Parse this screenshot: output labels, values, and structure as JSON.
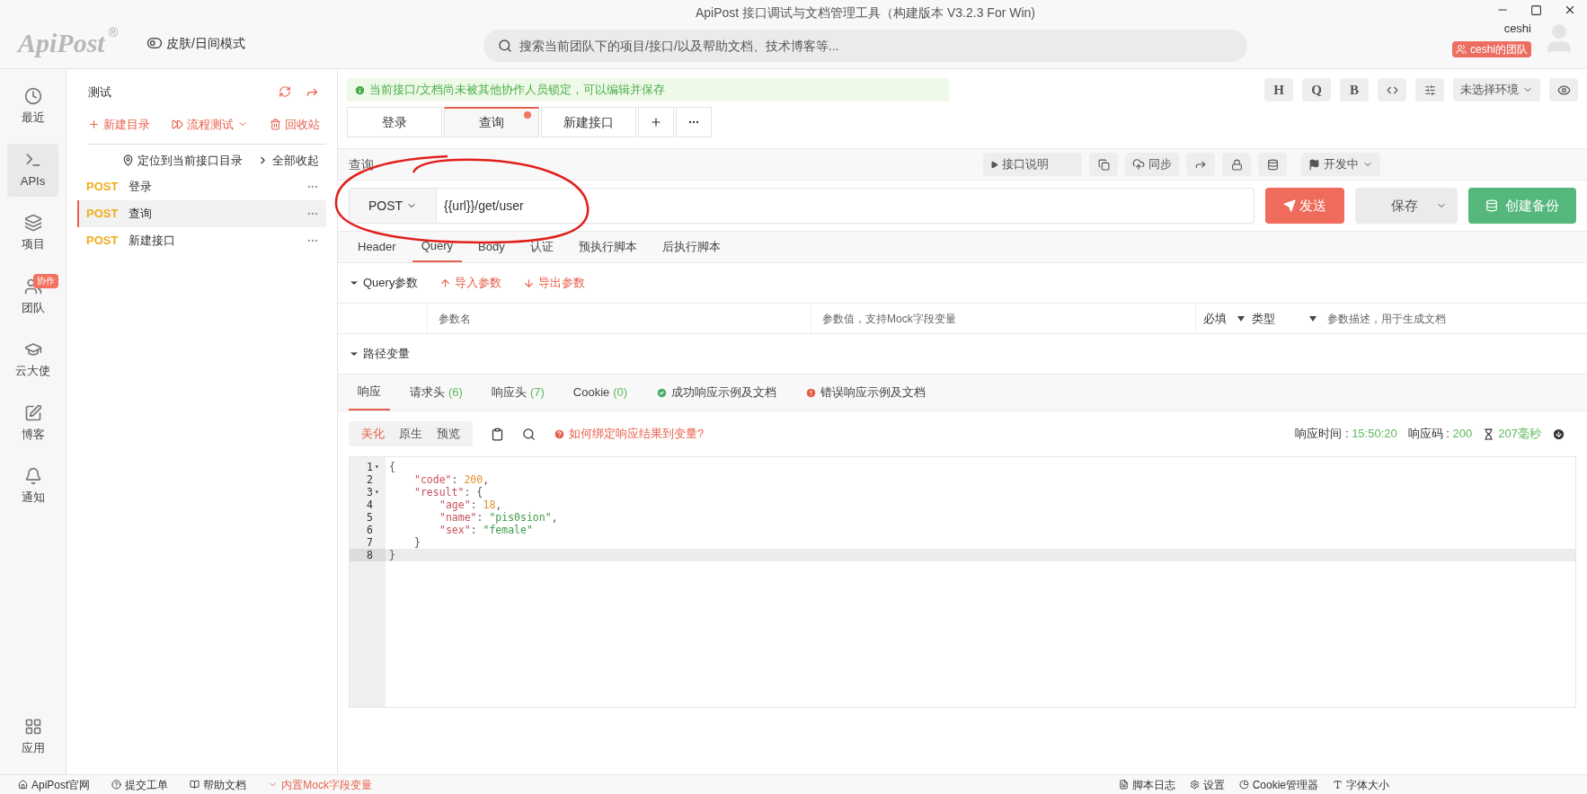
{
  "window": {
    "title": "ApiPost 接口调试与文档管理工具（构建版本 V3.2.3 For Win)"
  },
  "header": {
    "logo": "ApiPost",
    "logo_mark": "®",
    "theme_toggle": {
      "label": "皮肤/日间模式",
      "on": false
    },
    "search": {
      "placeholder": "搜索当前团队下的项目/接口/以及帮助文档、技术博客等..."
    },
    "user": {
      "name": "ceshi",
      "team": "ceshi的团队"
    }
  },
  "sidebar": {
    "items": [
      {
        "kind": "clock",
        "label": "最近",
        "selected": false
      },
      {
        "kind": "terminal",
        "label": "APIs",
        "selected": true
      },
      {
        "kind": "layers",
        "label": "项目",
        "selected": false
      },
      {
        "kind": "users",
        "label": "团队",
        "selected": false,
        "badge": "协作"
      },
      {
        "kind": "cap",
        "label": "云大使",
        "selected": false
      },
      {
        "kind": "edit",
        "label": "博客",
        "selected": false
      },
      {
        "kind": "bell",
        "label": "通知",
        "selected": false
      }
    ],
    "bottom_item": {
      "kind": "grid",
      "label": "应用",
      "selected": false
    }
  },
  "tree": {
    "title": "测试",
    "actions": [
      {
        "kind": "plus",
        "label": "新建目录"
      },
      {
        "kind": "flow",
        "label": "流程测试"
      },
      {
        "kind": "trash",
        "label": "回收站"
      }
    ],
    "locate": "定位到当前接口目录",
    "collapse": "全部收起",
    "items": [
      {
        "method": "POST",
        "name": "登录",
        "selected": false
      },
      {
        "method": "POST",
        "name": "查询",
        "selected": true
      },
      {
        "method": "POST",
        "name": "新建接口",
        "selected": false
      }
    ]
  },
  "notice": "当前接口/文档尚未被其他协作人员锁定，可以编辑并保存",
  "toolbar": {
    "buttons": [
      {
        "kind": "text",
        "label": "H"
      },
      {
        "kind": "text",
        "label": "Q"
      },
      {
        "kind": "text",
        "label": "B"
      },
      {
        "kind": "code"
      },
      {
        "kind": "sliders"
      }
    ],
    "environment": "未选择环境"
  },
  "tabs": [
    {
      "label": "登录",
      "selected": false,
      "unsaved": false
    },
    {
      "label": "查询",
      "selected": true,
      "unsaved": true
    },
    {
      "label": "新建接口",
      "selected": false,
      "unsaved": false
    }
  ],
  "request": {
    "name": "查询",
    "doc_button": "接口说明",
    "sync_button": "同步",
    "status": "开发中",
    "method": "POST",
    "url": "{{url}}/get/user",
    "send": "发送",
    "save": "保存",
    "backup": "创建备份"
  },
  "request_tabs": [
    {
      "label": "Header",
      "selected": false
    },
    {
      "label": "Query",
      "selected": true
    },
    {
      "label": "Body",
      "selected": false
    },
    {
      "label": "认证",
      "selected": false
    },
    {
      "label": "预执行脚本",
      "selected": false
    },
    {
      "label": "后执行脚本",
      "selected": false
    }
  ],
  "query": {
    "title": "Query参数",
    "expanded": true,
    "import": "导入参数",
    "export": "导出参数",
    "row": {
      "name_placeholder": "参数名",
      "value_placeholder": "参数值，支持Mock字段变量",
      "required": "必填",
      "type": "类型",
      "description_placeholder": "参数描述，用于生成文档"
    }
  },
  "path_vars": {
    "title": "路径变量",
    "expanded": true
  },
  "response_tabs": [
    {
      "kind": "plain",
      "label": "响应",
      "selected": true
    },
    {
      "kind": "plain",
      "label": "请求头",
      "count": "(6)",
      "selected": false
    },
    {
      "kind": "plain",
      "label": "响应头",
      "count": "(7)",
      "selected": false
    },
    {
      "kind": "plain",
      "label": "Cookie",
      "count": "(0)",
      "selected": false
    },
    {
      "kind": "success",
      "label": "成功响应示例及文档",
      "selected": false
    },
    {
      "kind": "error",
      "label": "错误响应示例及文档",
      "selected": false
    }
  ],
  "view_modes": [
    {
      "label": "美化",
      "selected": true
    },
    {
      "label": "原生",
      "selected": false
    },
    {
      "label": "预览",
      "selected": false
    }
  ],
  "help_link": "如何绑定响应结果到变量?",
  "meta": {
    "time_label": "响应时间 : ",
    "time": "15:50:20",
    "code_label": "响应码 : ",
    "code": "200",
    "duration": "207毫秒"
  },
  "code_lines": [
    {
      "number": "1",
      "fold_marker": "▾",
      "active": false,
      "kind": "outer",
      "tokens": [
        {
          "kind": "punct",
          "text": "{"
        }
      ]
    },
    {
      "number": "2",
      "active": false,
      "kind": "inner",
      "tokens": [
        {
          "kind": "key",
          "text": "\"code\""
        },
        {
          "kind": "punct",
          "text": ": "
        },
        {
          "kind": "number",
          "text": "200"
        },
        {
          "kind": "punct",
          "text": ","
        }
      ]
    },
    {
      "number": "3",
      "fold_marker": "▾",
      "active": false,
      "kind": "inner",
      "tokens": [
        {
          "kind": "key",
          "text": "\"result\""
        },
        {
          "kind": "punct",
          "text": ": {"
        }
      ]
    },
    {
      "number": "4",
      "active": false,
      "kind": "deep",
      "tokens": [
        {
          "kind": "key",
          "text": "\"age\""
        },
        {
          "kind": "punct",
          "text": ": "
        },
        {
          "kind": "number",
          "text": "18"
        },
        {
          "kind": "punct",
          "text": ","
        }
      ]
    },
    {
      "number": "5",
      "active": false,
      "kind": "deep",
      "tokens": [
        {
          "kind": "key",
          "text": "\"name\""
        },
        {
          "kind": "punct",
          "text": ": "
        },
        {
          "kind": "string",
          "text": "\"pis0sion\""
        },
        {
          "kind": "punct",
          "text": ","
        }
      ]
    },
    {
      "number": "6",
      "active": false,
      "kind": "deep",
      "tokens": [
        {
          "kind": "key",
          "text": "\"sex\""
        },
        {
          "kind": "punct",
          "text": ": "
        },
        {
          "kind": "string",
          "text": "\"female\""
        }
      ]
    },
    {
      "number": "7",
      "active": false,
      "kind": "inner",
      "tokens": [
        {
          "kind": "punct",
          "text": "}"
        }
      ]
    },
    {
      "number": "8",
      "active": true,
      "kind": "outer",
      "tokens": [
        {
          "kind": "punct",
          "text": "}"
        }
      ]
    }
  ],
  "status_bar": {
    "left": [
      {
        "kind": "home",
        "label": "ApiPost官网",
        "accent": false
      },
      {
        "kind": "help",
        "label": "提交工单",
        "accent": false
      },
      {
        "kind": "book",
        "label": "帮助文档",
        "accent": false
      },
      {
        "kind": "mock",
        "label": "内置Mock字段变量",
        "accent": true
      }
    ],
    "right": [
      {
        "kind": "file",
        "label": "脚本日志"
      },
      {
        "kind": "gear",
        "label": "设置"
      },
      {
        "kind": "pie",
        "label": "Cookie管理器"
      },
      {
        "kind": "font",
        "label": "字体大小"
      }
    ]
  }
}
